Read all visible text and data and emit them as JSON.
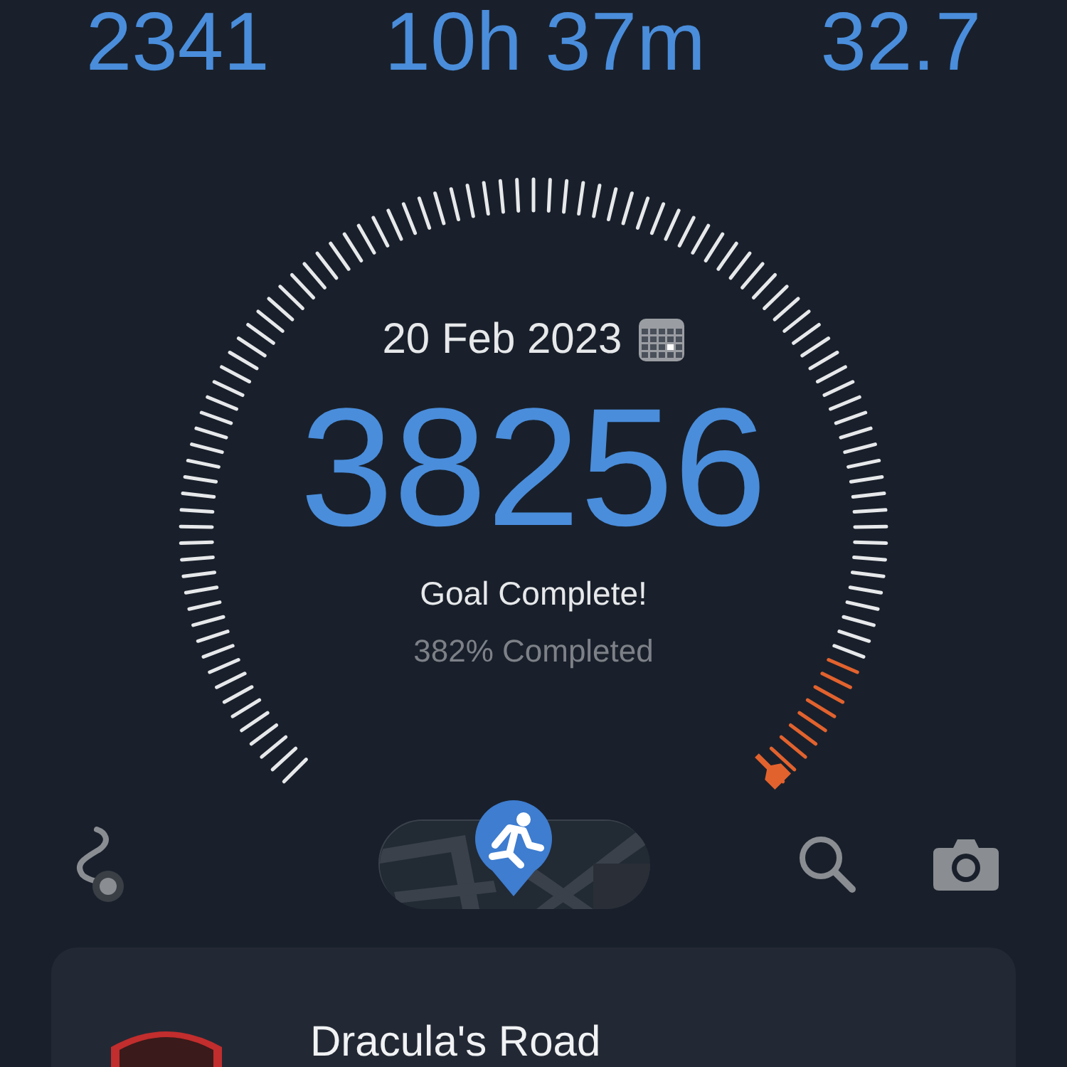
{
  "stats": [
    "2341",
    "10h 37m",
    "32.7"
  ],
  "gauge": {
    "date": "20 Feb 2023",
    "steps": "38256",
    "status": "Goal Complete!",
    "percent": "382% Completed"
  },
  "card": {
    "title": "Dracula's Road"
  }
}
